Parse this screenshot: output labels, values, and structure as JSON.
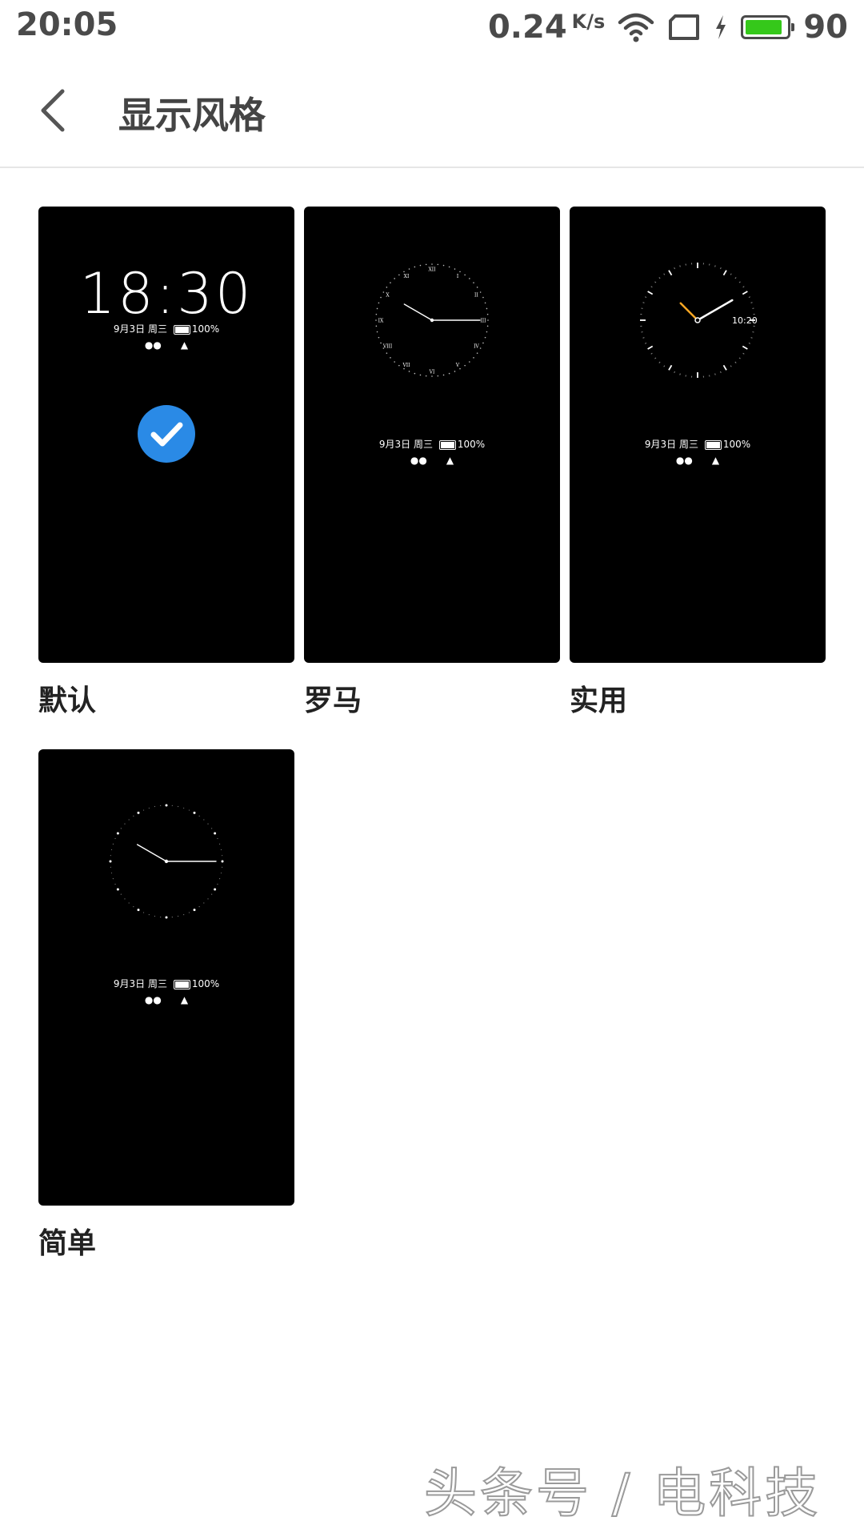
{
  "status_bar": {
    "time": "20:05",
    "net_speed": "0.24",
    "net_unit": "K/s",
    "battery": "90",
    "battery_level": 0.9,
    "battery_color": "#35c81a"
  },
  "header": {
    "title": "显示风格"
  },
  "styles": [
    {
      "label": "默认",
      "selected": true,
      "clock_time": "18:30",
      "date": "9月3日",
      "weekday": "周三",
      "battery": "100%",
      "app_icons": [
        "wechat-icon",
        "qq-icon"
      ]
    },
    {
      "label": "罗马",
      "selected": false,
      "numerals": [
        "XII",
        "I",
        "II",
        "III",
        "IV",
        "V",
        "VI",
        "VII",
        "VIII",
        "IX",
        "X",
        "XI"
      ],
      "date": "9月3日",
      "weekday": "周三",
      "battery": "100%",
      "app_icons": [
        "wechat-icon",
        "qq-icon"
      ]
    },
    {
      "label": "实用",
      "selected": false,
      "digital_time": "10:20",
      "hand_color": "#f5a623",
      "date": "9月3日",
      "weekday": "周三",
      "battery": "100%",
      "app_icons": [
        "wechat-icon",
        "qq-icon"
      ]
    },
    {
      "label": "简单",
      "selected": false,
      "date": "9月3日",
      "weekday": "周三",
      "battery": "100%",
      "app_icons": [
        "wechat-icon",
        "qq-icon"
      ]
    }
  ],
  "accent_color": "#2a8ae6",
  "watermark": "头条号 / 电科技"
}
